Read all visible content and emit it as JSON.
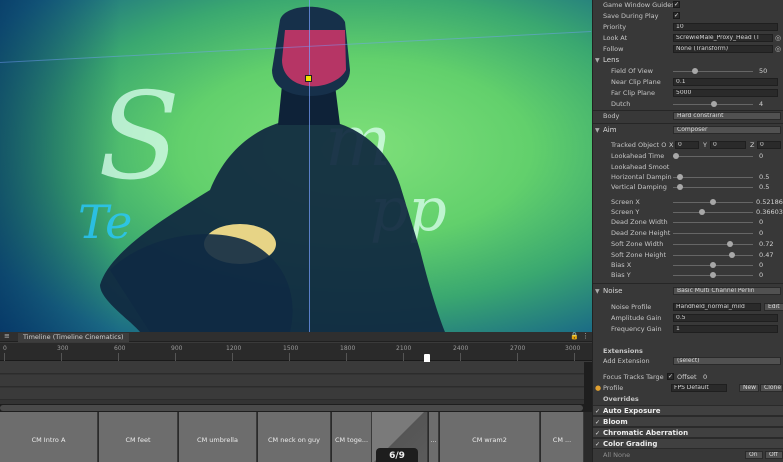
{
  "game_view": {
    "neon_letter_s": "S",
    "neon_letter_m": "m",
    "neon_text_pp": "pp",
    "neon_text_te": "Te"
  },
  "timeline": {
    "tab_title": "Timeline (Timeline Cinematics)",
    "ruler_ticks": [
      "0",
      "300",
      "600",
      "900",
      "1200",
      "1500",
      "1800",
      "2100",
      "2400",
      "2700",
      "3000"
    ],
    "clips": [
      "CM Intro A",
      "CM feet",
      "CM umbrella",
      "CM neck on guy",
      "CM toge...",
      "",
      "...",
      "CM wram2",
      "CM ..."
    ],
    "counter": "6/9"
  },
  "inspector": {
    "game_window_guides_label": "Game Window Guides",
    "save_during_play_label": "Save During Play",
    "priority_label": "Priority",
    "priority_value": "10",
    "look_at_label": "Look At",
    "look_at_value": "ScrewieMale_Proxy_Head (T",
    "follow_label": "Follow",
    "follow_value": "None (Transform)",
    "lens_label": "Lens",
    "fov_label": "Field Of View",
    "fov_value": "50",
    "near_clip_label": "Near Clip Plane",
    "near_clip_value": "0.1",
    "far_clip_label": "Far Clip Plane",
    "far_clip_value": "5000",
    "dutch_label": "Dutch",
    "dutch_value": "4",
    "body_label": "Body",
    "body_value": "Hard constraint",
    "aim_label": "Aim",
    "aim_value": "Composer",
    "tracked_offset_label": "Tracked Object O",
    "tracked_x_label": "X",
    "tracked_x_value": "0",
    "tracked_y_label": "Y",
    "tracked_y_value": "0",
    "tracked_z_label": "Z",
    "tracked_z_value": "0",
    "lookahead_time_label": "Lookahead Time",
    "lookahead_time_value": "0",
    "lookahead_smoothing_label": "Lookahead Smoot",
    "horizontal_damping_label": "Horizontal Dampin",
    "horizontal_damping_value": "0.5",
    "vertical_damping_label": "Vertical Damping",
    "vertical_damping_value": "0.5",
    "screen_x_label": "Screen X",
    "screen_x_value": "0.52186",
    "screen_y_label": "Screen Y",
    "screen_y_value": "0.36603",
    "dead_zone_width_label": "Dead Zone Width",
    "dead_zone_width_value": "0",
    "dead_zone_height_label": "Dead Zone Height",
    "dead_zone_height_value": "0",
    "soft_zone_width_label": "Soft Zone Width",
    "soft_zone_width_value": "0.72",
    "soft_zone_height_label": "Soft Zone Height",
    "soft_zone_height_value": "0.47",
    "bias_x_label": "Bias X",
    "bias_x_value": "0",
    "bias_y_label": "Bias Y",
    "bias_y_value": "0",
    "noise_label": "Noise",
    "noise_value": "Basic Multi Channel Perlin",
    "noise_profile_label": "Noise Profile",
    "noise_profile_value": "Handheld_normal_mild",
    "noise_profile_edit": "Edit",
    "amplitude_gain_label": "Amplitude Gain",
    "amplitude_gain_value": "0.5",
    "frequency_gain_label": "Frequency Gain",
    "frequency_gain_value": "1",
    "extensions_label": "Extensions",
    "add_extension_label": "Add Extension",
    "add_extension_value": "(select)",
    "focus_tracks_label": "Focus Tracks Targe",
    "focus_tracks_value": "Offset",
    "focus_tracks_number": "0",
    "profile_label": "Profile",
    "profile_value": "FPS Default",
    "profile_new": "New",
    "profile_clone": "Clone",
    "overrides_label": "Overrides",
    "overrides": [
      "Auto Exposure",
      "Bloom",
      "Chromatic Aberration",
      "Color Grading"
    ],
    "all_none_label": "All  None",
    "on_label": "On",
    "off_label": "Off"
  },
  "colors": {
    "panel_bg": "#383838",
    "timeline_clip": "#6d6d6d",
    "target_marker": "#f2e400"
  }
}
